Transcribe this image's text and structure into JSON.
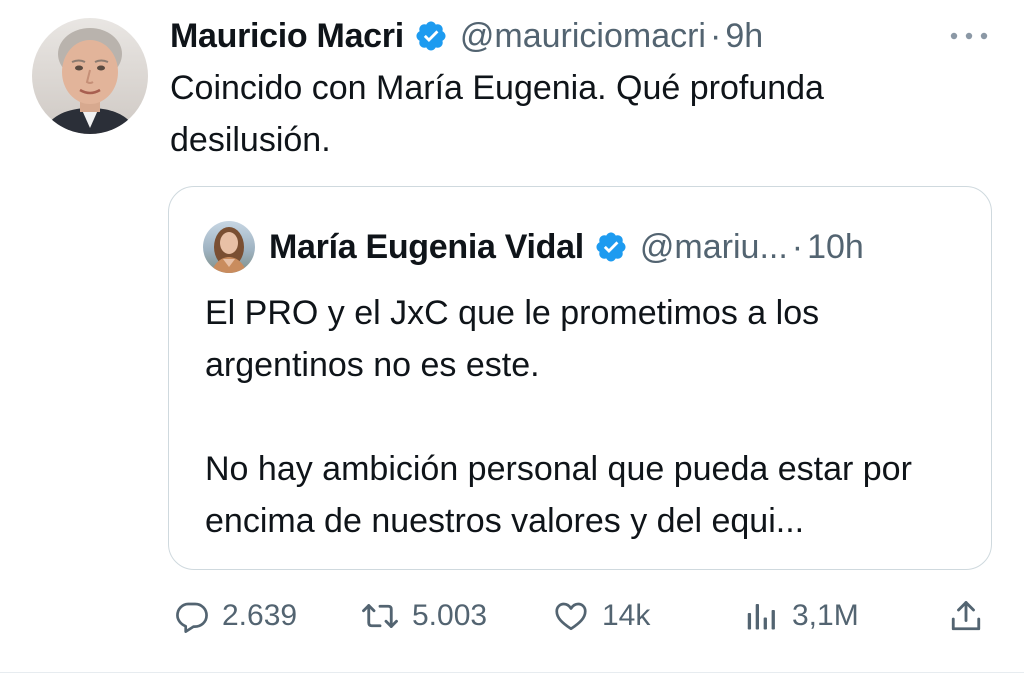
{
  "tweet": {
    "author": {
      "name": "Mauricio Macri",
      "handle": "@mauriciomacri",
      "verified": true,
      "avatar_icon": "profile-photo"
    },
    "separator": "·",
    "time": "9h",
    "text": "Coincido con María Eugenia. Qué profunda desilusión.",
    "more_icon": "more-horizontal-icon"
  },
  "quoted": {
    "author": {
      "name": "María Eugenia Vidal",
      "handle": "@mariu...",
      "verified": true,
      "avatar_icon": "profile-photo"
    },
    "separator": "·",
    "time": "10h",
    "paragraphs": [
      "El PRO y el JxC que le prometimos a los argentinos no es este.",
      "No hay ambición personal que pueda estar por encima de nuestros valores y del equi..."
    ]
  },
  "actions": {
    "reply": {
      "icon": "reply-icon",
      "count": "2.639"
    },
    "retweet": {
      "icon": "retweet-icon",
      "count": "5.003"
    },
    "like": {
      "icon": "heart-icon",
      "count": "14k"
    },
    "views": {
      "icon": "views-icon",
      "count": "3,1M"
    },
    "share": {
      "icon": "share-icon"
    }
  },
  "colors": {
    "verified_blue": "#1d9bf0",
    "secondary_text": "#536471",
    "primary_text": "#0f1419",
    "border": "#cfd9de"
  }
}
